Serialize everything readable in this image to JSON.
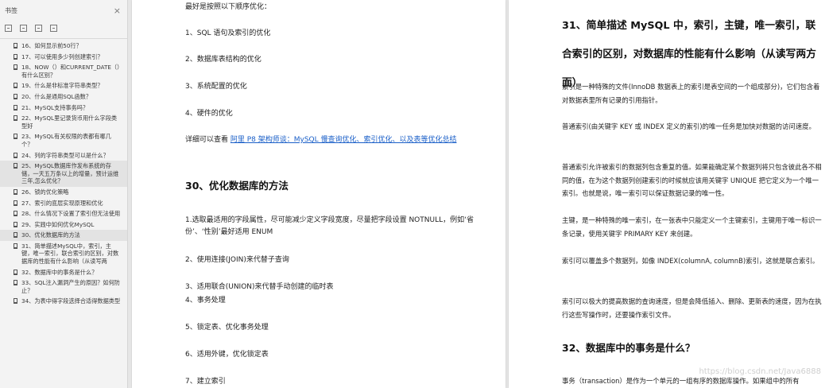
{
  "sidebar": {
    "title": "书签",
    "close_icon": "×",
    "items": [
      "16、如何显示前50行？",
      "17、可以使用多少列创建索引？",
      "18、NOW（）和CURRENT_DATE（）有什么区别？",
      "19、什么是非标准字符串类型？",
      "20、什么是通用SQL函数？",
      "21、MySQL支持事务吗？",
      "22、MySQL里记录货币用什么字段类型好",
      "23、MySQL有关权限的表都有哪几个？",
      "24、列的字符串类型可以是什么？",
      "25、MySQL数据库作发布系统的存储，一天五万条以上的增量，预计运维三年,怎么优化？",
      "26、锁的优化策略",
      "27、索引的底层实现原理和优化",
      "28、什么情况下设置了索引但无法使用",
      "29、实践中如何优化MySQL",
      "30、优化数据库的方法",
      "31、简单描述MySQL中，索引，主键，唯一索引，联合索引的区别，对数据库的性能有什么影响（从读写两",
      "32、数据库中的事务是什么？",
      "33、SQL注入漏洞产生的原因？如何防止？",
      "34、为表中得字段选择合适得数据类型"
    ]
  },
  "left_page": {
    "p1": "最好是按照以下顺序优化：",
    "p2": "1、SQL 语句及索引的优化",
    "p3": "2、数据库表结构的优化",
    "p4": "3、系统配置的优化",
    "p5": "4、硬件的优化",
    "p6_prefix": "详细可以查看 ",
    "p6_link": "阿里 P8 架构师谈：MySQL 慢查询优化、索引优化、以及表等优化总结",
    "h30": "30、优化数据库的方法",
    "l1": "1.选取最适用的字段属性，尽可能减少定义字段宽度，尽量把字段设置 NOTNULL，例如‘省份’、‘性别’最好适用 ENUM",
    "l2": "2、使用连接(JOIN)来代替子查询",
    "l3": "3、适用联合(UNION)来代替手动创建的临时表",
    "l4": "4、事务处理",
    "l5": "5、锁定表、优化事务处理",
    "l6": "6、适用外键，优化锁定表",
    "l7": "7、建立索引"
  },
  "right_page": {
    "h31": "31、简单描述 MySQL 中，索引，主键，唯一索引，联合索引的区别，对数据库的性能有什么影响（从读写两方面）",
    "p1": "索引是一种特殊的文件(InnoDB 数据表上的索引是表空间的一个组成部分)，它们包含着对数据表里所有记录的引用指针。",
    "p2": "普通索引(由关键字 KEY 或 INDEX 定义的索引)的唯一任务是加快对数据的访问速度。",
    "p3": "普通索引允许被索引的数据列包含重复的值。如果能确定某个数据列将只包含彼此各不相同的值，在为这个数据列创建索引的时候就应该用关键字 UNIQUE 把它定义为一个唯一索引。也就是说，唯一索引可以保证数据记录的唯一性。",
    "p4": "主键，是一种特殊的唯一索引，在一张表中只能定义一个主键索引，主键用于唯一标识一条记录，使用关键字 PRIMARY KEY 来创建。",
    "p5": "索引可以覆盖多个数据列，如像 INDEX(columnA, columnB)索引，这就是联合索引。",
    "p6": "索引可以极大的提高数据的查询速度，但是会降低插入、删除、更新表的速度，因为在执行这些写操作时，还要操作索引文件。",
    "h32": "32、数据库中的事务是什么？",
    "p7": "事务（transaction）是作为一个单元的一组有序的数据库操作。如果组中的所有",
    "watermark": "https://blog.csdn.net/Java6888"
  }
}
